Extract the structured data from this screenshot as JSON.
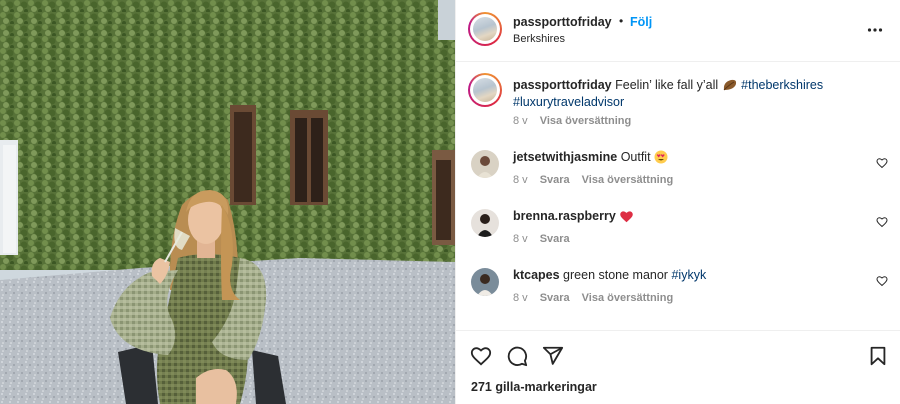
{
  "header": {
    "username": "passporttofriday",
    "separator": "•",
    "follow_label": "Följ",
    "location": "Berkshires"
  },
  "caption": {
    "username": "passporttofriday",
    "text": "Feelin’ like fall y’all",
    "emoji": "leaf-icon",
    "hashtag1": "#theberkshires",
    "hashtag2": "#luxurytraveladvisor",
    "time": "8 v",
    "translate": "Visa översättning"
  },
  "comments": [
    {
      "username": "jetsetwithjasmine",
      "text": "Outfit",
      "emoji": "heart-eyes-emoji",
      "time": "8 v",
      "reply": "Svara",
      "translate": "Visa översättning"
    },
    {
      "username": "brenna.raspberry",
      "text": "",
      "emoji": "red-heart-emoji",
      "time": "8 v",
      "reply": "Svara"
    },
    {
      "username": "ktcapes",
      "text": "green stone manor",
      "hashtag": "#iykyk",
      "time": "8 v",
      "reply": "Svara",
      "translate": "Visa översättning"
    }
  ],
  "actions": {
    "likes": "271 gilla-markeringar"
  },
  "colors": {
    "link": "#0095f6",
    "hashtag": "#00376b",
    "muted": "#8e8e8e",
    "text": "#262626"
  }
}
